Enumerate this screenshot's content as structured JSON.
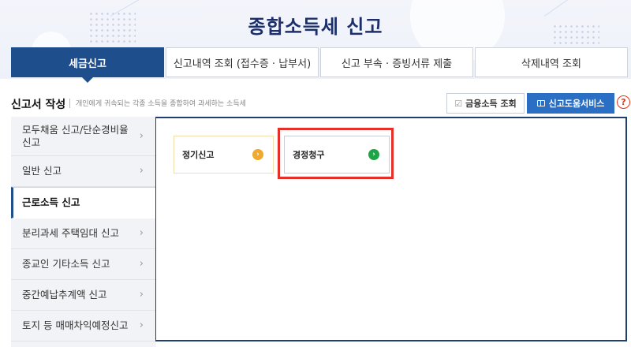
{
  "header": {
    "title": "종합소득세 신고"
  },
  "tabs": [
    {
      "label": "세금신고",
      "active": true
    },
    {
      "label": "신고내역 조회 (접수증 · 납부서)",
      "active": false
    },
    {
      "label": "신고 부속 · 증빙서류 제출",
      "active": false
    },
    {
      "label": "삭제내역 조회",
      "active": false
    }
  ],
  "section": {
    "title": "신고서 작성",
    "description": "개인에게 귀속되는 각종 소득을 종합하여 과세하는 소득세",
    "finance_button": "금융소득 조회",
    "finance_icon": "checkbox-edit-icon",
    "help_service_button": "신고도움서비스",
    "help_service_icon": "book-icon",
    "help_symbol": "?"
  },
  "sidebar": {
    "items": [
      {
        "label": "모두채움 신고/단순경비율 신고",
        "active": false
      },
      {
        "label": "일반 신고",
        "active": false
      },
      {
        "label": "근로소득 신고",
        "active": true
      },
      {
        "label": "분리과세 주택임대 신고",
        "active": false
      },
      {
        "label": "종교인 기타소득 신고",
        "active": false
      },
      {
        "label": "중간예납추계액 신고",
        "active": false
      },
      {
        "label": "토지 등 매매차익예정신고",
        "active": false
      }
    ]
  },
  "content": {
    "cards": [
      {
        "label": "정기신고",
        "icon": "arrow-right-circle-icon",
        "accent": "#f0a92b"
      },
      {
        "label": "경정청구",
        "icon": "arrow-right-circle-icon",
        "accent": "#1fa347",
        "highlighted": true
      }
    ]
  },
  "colors": {
    "primary": "#1f4e8c",
    "help_button": "#2a6fc4",
    "highlight": "#e5302a",
    "title": "#1c2f6b"
  }
}
